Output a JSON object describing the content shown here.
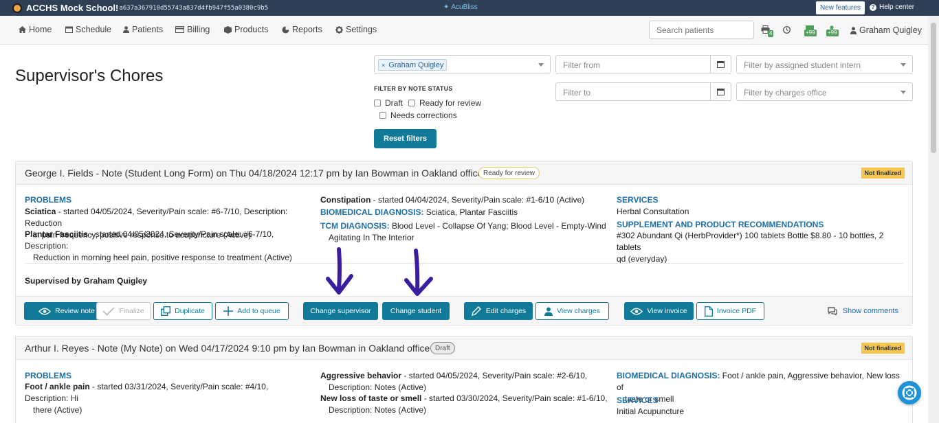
{
  "titlebar": {
    "school": "ACCHS Mock School!",
    "hash": "a637a367910d55743a837d4fb947f55a0380c9b5",
    "brand": "AcuBliss",
    "new_features": "New features",
    "help_center": "Help center"
  },
  "nav": {
    "items": [
      "Home",
      "Schedule",
      "Patients",
      "Billing",
      "Products",
      "Reports",
      "Settings"
    ],
    "search_placeholder": "Search patients",
    "badges": {
      "queue": "4",
      "plus1": "+99",
      "plus2": "+99"
    },
    "user": "Graham Quigley"
  },
  "page": {
    "title": "Supervisor's Chores"
  },
  "filters": {
    "supervisor_tag": "Graham Quigley",
    "filter_from_placeholder": "Filter from",
    "filter_to_placeholder": "Filter to",
    "intern_placeholder": "Filter by assigned student intern",
    "office_placeholder": "Filter by charges office",
    "status_label": "FILTER BY NOTE STATUS",
    "status_options": [
      "Draft",
      "Ready for review",
      "Needs corrections"
    ],
    "reset": "Reset filters"
  },
  "notes": [
    {
      "title": "George I. Fields - Note (Student Long Form) on Thu 04/18/2024 12:17 pm by Ian Bowman in Oakland office",
      "status": "Ready for review",
      "finalized_label": "Not finalized",
      "problems_head": "PROBLEMS",
      "problems": [
        {
          "name": "Sciatica",
          "line1": " - started 04/05/2024, Severity/Pain scale: #6-7/10, Description: Reduction",
          "line2": "in pain frequency, positive response to acupuncture (Active)"
        },
        {
          "name": "Plantar Fasciitis",
          "line1": " - started 04/05/2024, Severity/Pain scale: #6-7/10, Description:",
          "line2": "Reduction in morning heel pain, positive response to treatment (Active)"
        }
      ],
      "mid": {
        "constipation_name": "Constipation",
        "constipation_text": " - started 04/04/2024, Severity/Pain scale: #1-6/10 (Active)",
        "biomed_head": "BIOMEDICAL DIAGNOSIS:",
        "biomed_text": " Sciatica, Plantar Fasciitis",
        "tcm_head": "TCM DIAGNOSIS:",
        "tcm_line1": " Blood Level - Collapse Of Yang; Blood Level - Empty-Wind",
        "tcm_line2": "Agitating In The Interior"
      },
      "services_head": "SERVICES",
      "services_text": "Herbal Consultation",
      "supp_head": "SUPPLEMENT AND PRODUCT RECOMMENDATIONS",
      "supp_line1": "#302 Abundant Qi (HerbProvider*) 100 tablets Bottle $8.80 - 10 bottles, 2 tablets",
      "supp_line2": "qd (everyday)",
      "supervised": "Supervised by Graham Quigley",
      "actions": {
        "review": "Review note",
        "finalize": "Finalize",
        "duplicate": "Duplicate",
        "queue": "Add to queue",
        "change_supervisor": "Change supervisor",
        "change_student": "Change student",
        "edit_charges": "Edit charges",
        "view_charges": "View charges",
        "view_invoice": "View invoice",
        "invoice_pdf": "Invoice PDF",
        "show_comments": "Show comments"
      }
    },
    {
      "title": "Arthur I. Reyes - Note (My Note) on Wed 04/17/2024 9:10 pm by Ian Bowman in Oakland office",
      "status": "Draft",
      "finalized_label": "Not finalized",
      "problems_head": "PROBLEMS",
      "problem_name": "Foot / ankle pain",
      "problem_line1": " - started 03/31/2024, Severity/Pain scale: #4/10, Description: Hi",
      "problem_line2": "there (Active)",
      "mid": {
        "p1_name": "Aggressive behavior",
        "p1_line1": " - started 04/05/2024, Severity/Pain scale: #2-6/10,",
        "p1_line2": "Description: Notes (Active)",
        "p2_name": "New loss of taste or smell",
        "p2_line1": " - started 03/30/2024, Severity/Pain scale: #1-6/10,",
        "p2_line2": "Description: Notes (Active)"
      },
      "biomed_head": "BIOMEDICAL DIAGNOSIS:",
      "biomed_line1": " Foot / ankle pain, Aggressive behavior, New loss of",
      "biomed_line2": "taste or smell",
      "services_head": "SERVICES",
      "services_text": "Initial Acupuncture"
    }
  ],
  "colors": {
    "accent": "#117a99",
    "link": "#1e6fa8",
    "titlebar": "#2e3f56",
    "annotation_arrow": "#3b1ea0"
  }
}
